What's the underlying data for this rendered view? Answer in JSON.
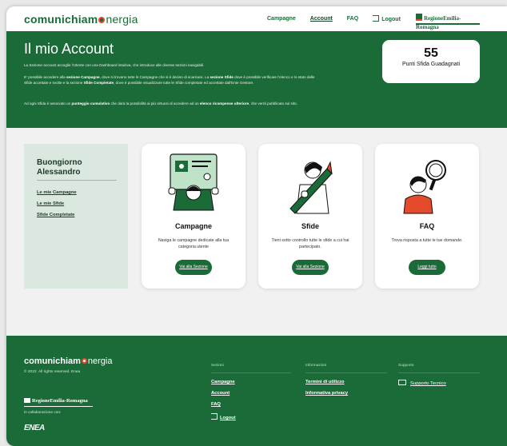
{
  "header": {
    "logo_main": "comunichiam",
    "logo_light": "nergia",
    "nav": [
      "Campagne",
      "Account",
      "FAQ"
    ],
    "logout": "Logout",
    "region": "RegioneEmilia-Romagna"
  },
  "hero": {
    "title": "Il mio Account",
    "intro": "La Sezione account accoglie l'Utente con una Dashboard intuitiva, che introduce alle diverse sezioni navigabili.",
    "p2_a": "E' possibile accedere alla ",
    "p2_b": "sezione Campagne",
    "p2_c": ", dove si trovano tutte le Campagne che si è deciso di scaricare. La ",
    "p2_d": "sezione Sfide",
    "p2_e": " dove è possibile verificare l'elenco e lo stato delle Sfide accettate e svolte e la sezione ",
    "p2_f": "Sfide Completate",
    "p2_g": ", dove è possibile visualizzare tutte le Sfide completate ed accettate dall'Ente Gestore.",
    "p3_a": "Ad ogni Sfida è associato un ",
    "p3_b": "punteggio cumulativo",
    "p3_c": " che darà la possibilità ai più virtuosi di accedere ad un ",
    "p3_d": "elenco ricompense ulteriore",
    "p3_e": ", che verrà pubblicato sul sito.",
    "points_value": "55",
    "points_label": "Punti Sfida Guadagnati"
  },
  "sidebar": {
    "greeting": "Buongiorno Alessandro",
    "links": [
      "Le mie Campagne",
      "Le mie Sfide",
      "Sfide Completate"
    ]
  },
  "cards": [
    {
      "title": "Campagne",
      "desc": "Naviga le campagne dedicate alla tua categoria utente",
      "button": "Vai alla Sezione"
    },
    {
      "title": "Sfide",
      "desc": "Tieni sotto controllo tutte le sfide a cui hai partecipato.",
      "button": "Vai alla Sezione"
    },
    {
      "title": "FAQ",
      "desc": "Trova risposta a tutte le tue domande.",
      "button": "Leggi tutto"
    }
  ],
  "footer": {
    "copyright": "© 2022. All rights reserved. Enea",
    "collab": "in collaborazione con:",
    "enea": "ENEA",
    "col1_head": "Sezioni",
    "col1_links": [
      "Campagne",
      "Account",
      "FAQ",
      "Logout"
    ],
    "col2_head": "Informazioni",
    "col2_links": [
      "Termini di utilizzo",
      "Informativa privacy"
    ],
    "col3_head": "Supporto",
    "col3_link": "Supporto Tecnico"
  },
  "colors": {
    "brand_green": "#1a6b38",
    "accent_orange": "#e54b2a",
    "sidebar_bg": "#dbe8e0"
  }
}
